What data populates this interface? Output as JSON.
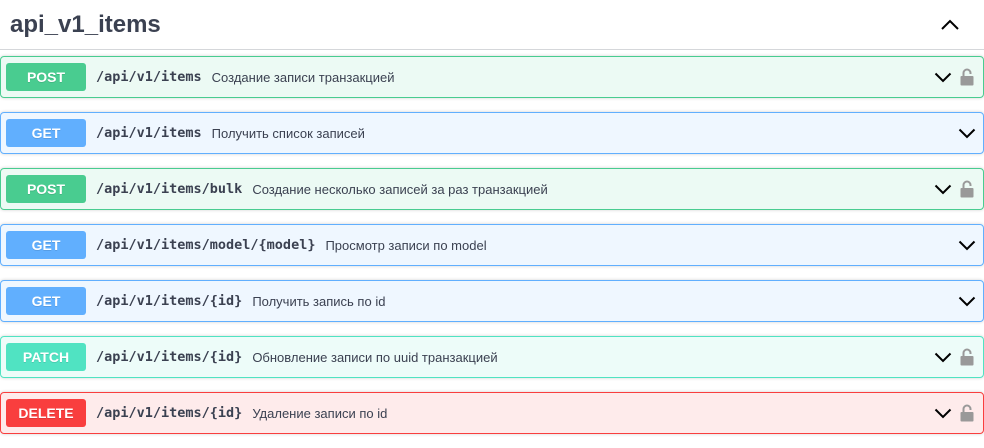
{
  "tag": {
    "title": "api_v1_items"
  },
  "operations": [
    {
      "method": "POST",
      "path": "/api/v1/items",
      "summary": "Создание записи транзакцией"
    },
    {
      "method": "GET",
      "path": "/api/v1/items",
      "summary": "Получить список записей"
    },
    {
      "method": "POST",
      "path": "/api/v1/items/bulk",
      "summary": "Создание несколько записей за раз транзакцией"
    },
    {
      "method": "GET",
      "path": "/api/v1/items/model/{model}",
      "summary": "Просмотр записи по model"
    },
    {
      "method": "GET",
      "path": "/api/v1/items/{id}",
      "summary": "Получить запись по id"
    },
    {
      "method": "PATCH",
      "path": "/api/v1/items/{id}",
      "summary": "Обновление записи по uuid транзакцией"
    },
    {
      "method": "DELETE",
      "path": "/api/v1/items/{id}",
      "summary": "Удаление записи по id"
    }
  ],
  "icons": {
    "collapse": "chevron-up-icon",
    "expand": "chevron-down-icon",
    "lock": "lock-icon"
  },
  "colors": {
    "post": "#49cc90",
    "get": "#61affe",
    "patch": "#50e3c2",
    "delete": "#f93e3e",
    "lock": "#999999"
  }
}
